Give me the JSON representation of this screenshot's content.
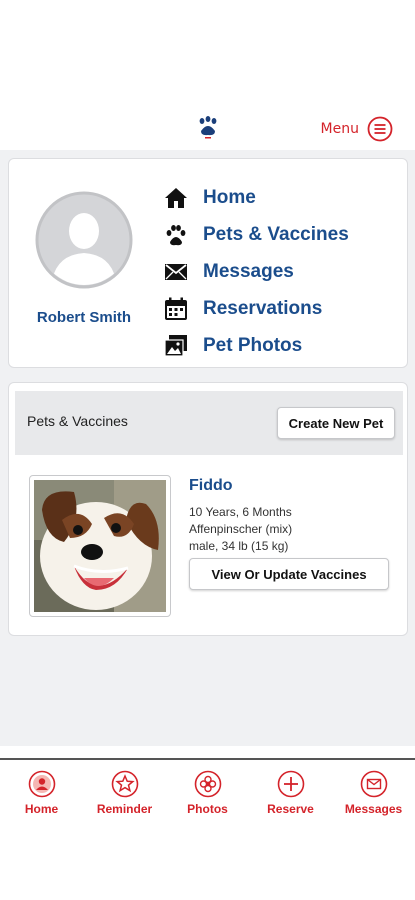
{
  "header": {
    "logo_icon": "paw-logo-icon",
    "menu_label": "Menu",
    "menu_icon": "hamburger-circle-icon",
    "accent_color": "#d4232a"
  },
  "profile": {
    "avatar_icon": "user-silhouette-icon",
    "user_name": "Robert Smith"
  },
  "nav": {
    "items": [
      {
        "label": "Home",
        "icon": "house-icon"
      },
      {
        "label": "Pets & Vaccines",
        "icon": "paw-icon"
      },
      {
        "label": "Messages",
        "icon": "envelope-icon"
      },
      {
        "label": "Reservations",
        "icon": "calendar-icon"
      },
      {
        "label": "Pet Photos",
        "icon": "photos-icon"
      }
    ],
    "link_color": "#1b4d8c"
  },
  "pets_section": {
    "title": "Pets & Vaccines",
    "create_button": "Create New Pet",
    "pets": [
      {
        "name": "Fiddo",
        "age": "10 Years, 6 Months",
        "breed": "Affenpinscher (mix)",
        "sex_weight": "male, 34 lb (15 kg)",
        "action_button": "View Or Update Vaccines",
        "photo_icon": "dog-photo"
      }
    ]
  },
  "tabbar": {
    "tabs": [
      {
        "label": "Home",
        "icon": "user-circle-icon"
      },
      {
        "label": "Reminder",
        "icon": "star-circle-icon"
      },
      {
        "label": "Photos",
        "icon": "flower-circle-icon"
      },
      {
        "label": "Reserve",
        "icon": "plus-circle-icon"
      },
      {
        "label": "Messages",
        "icon": "mail-circle-icon"
      }
    ]
  }
}
